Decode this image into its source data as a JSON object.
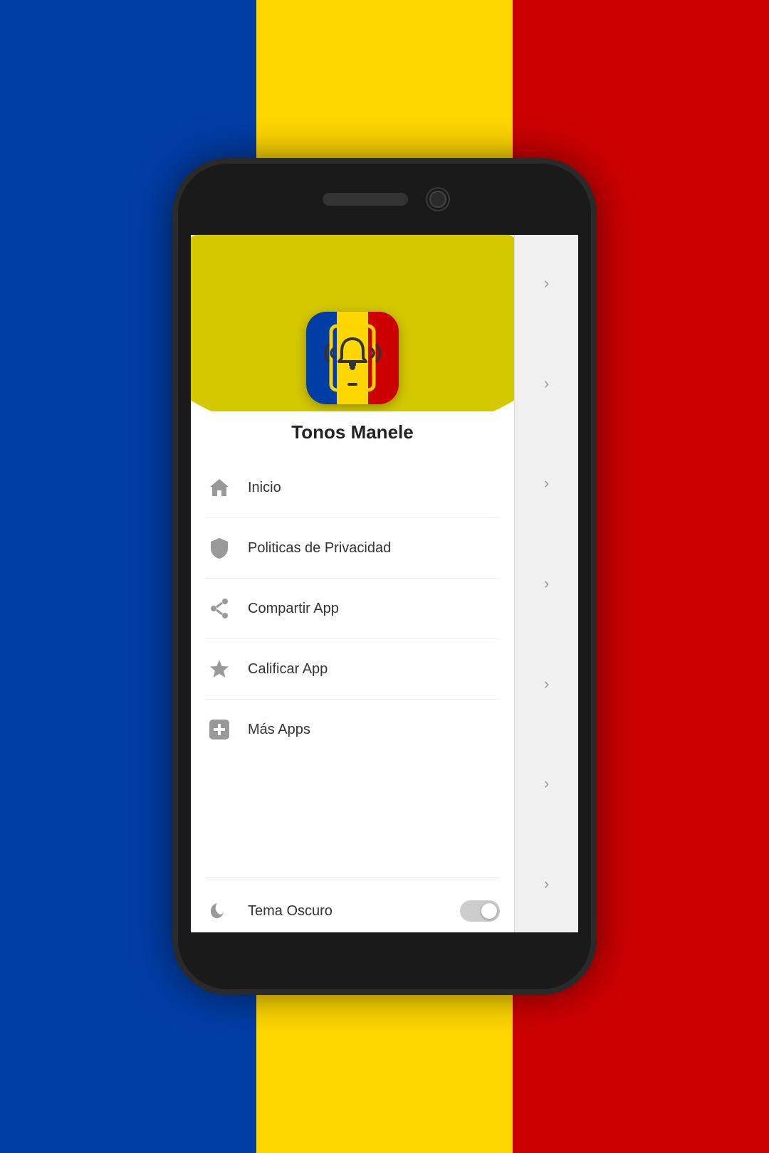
{
  "background": {
    "blue": "#003DA5",
    "yellow": "#FFD700",
    "red": "#CC0001"
  },
  "app": {
    "title": "Tonos Manele"
  },
  "menu": {
    "items": [
      {
        "id": "inicio",
        "label": "Inicio",
        "icon": "home"
      },
      {
        "id": "privacidad",
        "label": "Politicas de Privacidad",
        "icon": "shield"
      },
      {
        "id": "compartir",
        "label": "Compartir App",
        "icon": "share"
      },
      {
        "id": "calificar",
        "label": "Calificar App",
        "icon": "star"
      },
      {
        "id": "mas-apps",
        "label": "Más Apps",
        "icon": "plus-box"
      }
    ]
  },
  "settings": {
    "dark_mode_label": "Tema Oscuro",
    "dark_mode_enabled": false
  },
  "sidebar": {
    "chevron": "›"
  }
}
